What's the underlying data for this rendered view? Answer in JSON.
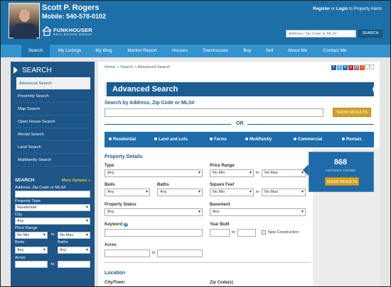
{
  "agent": {
    "name": "Scott P. Rogers",
    "phone": "Mobile: 540-578-0102"
  },
  "brand": {
    "name": "FUNKHOUSER",
    "tagline": "REAL ESTATE GROUP"
  },
  "top_links": {
    "register": "Register",
    "or": "or",
    "login": "Login",
    "suffix": "to Property Alerts"
  },
  "header_search": {
    "placeholder": "Address, Zip Code or MLS#",
    "button": "SEARCH"
  },
  "nav": [
    "Search",
    "My Listings",
    "My Blog",
    "Market Report",
    "Houses",
    "Townhouses",
    "Buy",
    "Sell",
    "About Me",
    "Contact Me"
  ],
  "sidebar": {
    "heading": "SEARCH",
    "links": [
      "Advanced Search",
      "Proximity Search",
      "Map Search",
      "Open House Search",
      "Rental Search",
      "Land Search",
      "Multifamily Search"
    ],
    "quick": {
      "title": "SEARCH",
      "more": "More Options »",
      "address_label": "Address, Zip Code or MLS#",
      "type_label": "Property Type",
      "type_value": "Residential",
      "city_label": "City",
      "city_value": "Any",
      "price_label": "Price Range",
      "price_min": "No Min",
      "price_max": "No Max",
      "to": "to",
      "beds_label": "Beds",
      "beds_value": "Any",
      "baths_label": "Baths",
      "baths_value": "Any",
      "acres_label": "Acres"
    }
  },
  "breadcrumb": {
    "home": "Home",
    "sep": "»",
    "search": "Search",
    "current": "Advanced Search"
  },
  "share_count": "0",
  "page_title": "Advanced Search",
  "search_by_label": "Search by Address, Zip Code or MLS#",
  "show_results": "SHOW RESULTS",
  "or_label": "OR",
  "property_types": [
    "Residential",
    "Land and Lots",
    "Farms",
    "Multifamily",
    "Commercial",
    "Rentals"
  ],
  "details": {
    "section": "Property Details",
    "type_label": "Type",
    "type_value": "Any",
    "price_label": "Price Range",
    "price_min": "No Min",
    "price_max": "No Max",
    "to": "to",
    "beds_label": "Beds",
    "beds_value": "Any",
    "baths_label": "Baths",
    "baths_value": "Any",
    "sqft_label": "Square Feet",
    "sqft_min": "No Min",
    "sqft_max": "No Max",
    "status_label": "Property Status",
    "status_value": "Any",
    "basement_label": "Basement",
    "basement_value": "Any",
    "keyword_label": "Keyword",
    "year_label": "Year Built",
    "new_construction": "New Construction",
    "acres_label": "Acres"
  },
  "location": {
    "section": "Location",
    "city_label": "City/Town",
    "zip_label": "Zip Code(s)"
  },
  "results": {
    "count": "868",
    "label": "LISTINGS FOUND",
    "button": "SHOW RESULTS"
  }
}
